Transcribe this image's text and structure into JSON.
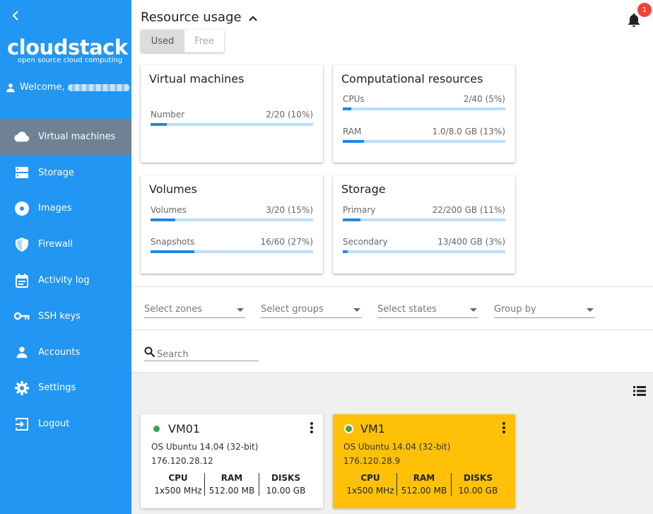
{
  "sidebar": {
    "logo": "cloudstack",
    "tagline": "open source cloud computing",
    "welcome": "Welcome,",
    "items": [
      {
        "label": "Virtual machines",
        "icon": "cloud-icon"
      },
      {
        "label": "Storage",
        "icon": "storage-icon"
      },
      {
        "label": "Images",
        "icon": "disc-icon"
      },
      {
        "label": "Firewall",
        "icon": "shield-icon"
      },
      {
        "label": "Activity log",
        "icon": "calendar-icon"
      },
      {
        "label": "SSH keys",
        "icon": "key-icon"
      },
      {
        "label": "Accounts",
        "icon": "person-icon"
      },
      {
        "label": "Settings",
        "icon": "gear-icon"
      },
      {
        "label": "Logout",
        "icon": "logout-icon"
      }
    ]
  },
  "header": {
    "title": "Resource usage",
    "notification_count": "1",
    "toggle": {
      "used": "Used",
      "free": "Free"
    }
  },
  "cards": {
    "vms": {
      "title": "Virtual machines",
      "metrics": [
        {
          "label": "Number",
          "value": "2/20 (10%)",
          "percent": 10
        }
      ]
    },
    "compute": {
      "title": "Computational resources",
      "metrics": [
        {
          "label": "CPUs",
          "value": "2/40 (5%)",
          "percent": 5
        },
        {
          "label": "RAM",
          "value": "1.0/8.0 GB (13%)",
          "percent": 13
        }
      ]
    },
    "volumes": {
      "title": "Volumes",
      "metrics": [
        {
          "label": "Volumes",
          "value": "3/20 (15%)",
          "percent": 15
        },
        {
          "label": "Snapshots",
          "value": "16/60 (27%)",
          "percent": 27
        }
      ]
    },
    "storage": {
      "title": "Storage",
      "metrics": [
        {
          "label": "Primary",
          "value": "22/200 GB (11%)",
          "percent": 11
        },
        {
          "label": "Secondary",
          "value": "13/400 GB (3%)",
          "percent": 3
        }
      ]
    }
  },
  "filters": {
    "zones": "Select zones",
    "groups": "Select groups",
    "states": "Select states",
    "group_by": "Group by",
    "search_placeholder": "Search"
  },
  "vms": [
    {
      "name": "VM01",
      "os": "OS Ubuntu 14.04 (32-bit)",
      "ip": "176.120.28.12",
      "cpu_label": "CPU",
      "cpu": "1x500 MHz",
      "ram_label": "RAM",
      "ram": "512.00 MB",
      "disks_label": "DISKS",
      "disks": "10.00 GB",
      "bg": "#ffffff"
    },
    {
      "name": "VM1",
      "os": "OS Ubuntu 14.04 (32-bit)",
      "ip": "176.120.28.9",
      "cpu_label": "CPU",
      "cpu": "1x500 MHz",
      "ram_label": "RAM",
      "ram": "512.00 MB",
      "disks_label": "DISKS",
      "disks": "10.00 GB",
      "bg": "#ffc107"
    }
  ],
  "colors": {
    "sidebar": "#2196f3",
    "active_nav": "#6e8294",
    "bar_fill": "#1e88e5",
    "bar_track": "#bbdefb",
    "status_running": "#43a047"
  }
}
